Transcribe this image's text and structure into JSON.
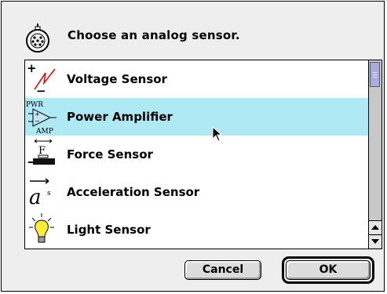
{
  "dialog": {
    "prompt": "Choose an analog sensor.",
    "header_icon": "connector-plug-icon"
  },
  "sensors": [
    {
      "label": "Voltage Sensor",
      "icon": "voltage-icon",
      "selected": false
    },
    {
      "label": "Power Amplifier",
      "icon": "power-amplifier-icon",
      "selected": true
    },
    {
      "label": "Force Sensor",
      "icon": "force-icon",
      "selected": false
    },
    {
      "label": "Acceleration Sensor",
      "icon": "acceleration-icon",
      "selected": false
    },
    {
      "label": "Light Sensor",
      "icon": "lightbulb-icon",
      "selected": false
    }
  ],
  "icon_text": {
    "voltage_plus": "+",
    "voltage_minus": "−",
    "amp_top": "PWR",
    "amp_bottom": "AMP",
    "force_letter": "F",
    "accel_letter": "a",
    "accel_sub": "s"
  },
  "buttons": {
    "cancel": "Cancel",
    "ok": "OK"
  },
  "colors": {
    "selection": "#aee9f4",
    "scroll_thumb": "#aaaadd",
    "bulb": "#ffee33"
  }
}
